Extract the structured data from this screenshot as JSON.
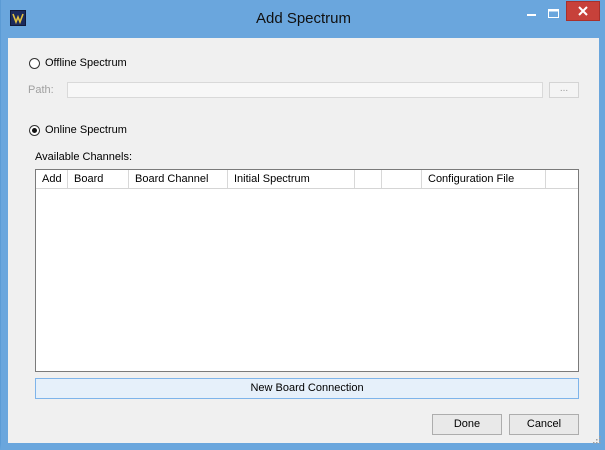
{
  "window": {
    "title": "Add Spectrum",
    "colors": {
      "frame": "#6aa6dd",
      "close": "#c7413a"
    },
    "controls": {
      "minimize_icon": "minimize-icon",
      "maximize_icon": "maximize-icon",
      "close_icon": "close-icon"
    }
  },
  "offline": {
    "label": "Offline Spectrum",
    "selected": false,
    "path_label": "Path:",
    "path_value": "",
    "browse_label": "..."
  },
  "online": {
    "label": "Online Spectrum",
    "selected": true,
    "channels_label": "Available Channels:"
  },
  "grid": {
    "columns": [
      "Add",
      "Board",
      "Board Channel",
      "Initial Spectrum",
      "",
      "",
      "Configuration File",
      ""
    ],
    "rows": []
  },
  "actions": {
    "new_board_connection": "New Board Connection",
    "done": "Done",
    "cancel": "Cancel"
  }
}
